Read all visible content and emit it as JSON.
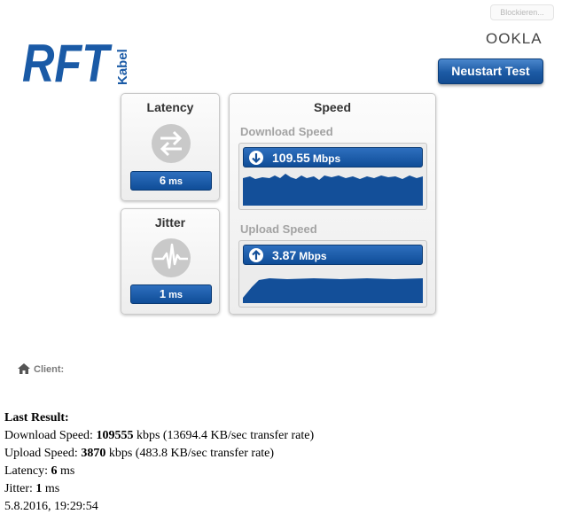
{
  "blocker_label": "Blockieren...",
  "logo_text": "RFT",
  "logo_sub": "Kabel",
  "ookla": "OOKLA",
  "restart_label": "Neustart Test",
  "latency": {
    "title": "Latency",
    "value": "6",
    "unit": "ms"
  },
  "jitter": {
    "title": "Jitter",
    "value": "1",
    "unit": "ms"
  },
  "speed": {
    "title": "Speed",
    "download": {
      "title": "Download Speed",
      "value": "109.55",
      "unit": "Mbps"
    },
    "upload": {
      "title": "Upload Speed",
      "value": "3.87",
      "unit": "Mbps"
    }
  },
  "client_label": "Client:",
  "last_result": {
    "heading": "Last Result:",
    "download_label": "Download Speed: ",
    "download_kbps": "109555",
    "download_rest": " kbps (13694.4 KB/sec transfer rate)",
    "upload_label": "Upload Speed: ",
    "upload_kbps": "3870",
    "upload_rest": " kbps (483.8 KB/sec transfer rate)",
    "latency_label": "Latency: ",
    "latency_value": "6",
    "latency_unit": " ms",
    "jitter_label": "Jitter: ",
    "jitter_value": "1",
    "jitter_unit": " ms",
    "timestamp": "5.8.2016, 19:29:54"
  },
  "colors": {
    "brand_blue": "#1a5aa6",
    "graph_fill": "#134f99",
    "panel_bg": "#f4f4f4"
  }
}
